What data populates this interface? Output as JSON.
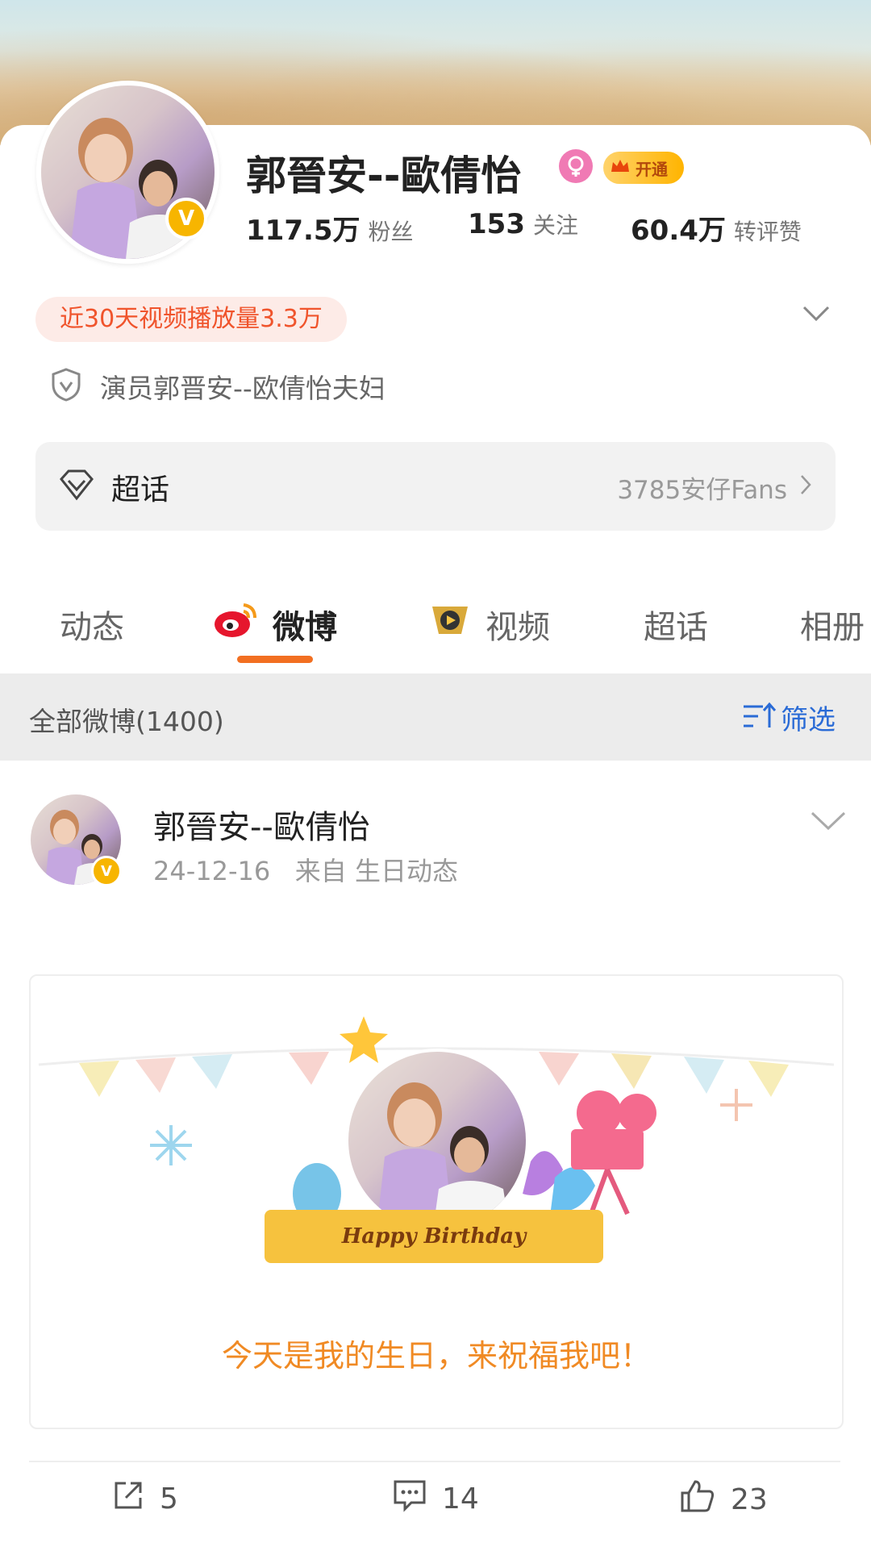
{
  "profile": {
    "name": "郭晉安--歐倩怡",
    "vip_label": "开通",
    "stats": [
      {
        "value": "117.5万",
        "label": "粉丝"
      },
      {
        "value": "153",
        "label": "关注"
      },
      {
        "value": "60.4万",
        "label": "转评赞"
      }
    ],
    "video_pill": "近30天视频播放量3.3万",
    "verification": "演员郭晋安--欧倩怡夫妇"
  },
  "chaohua": {
    "label": "超话",
    "fans": "3785安仔Fans"
  },
  "tabs": [
    "动态",
    "微博",
    "视频",
    "超话",
    "相册"
  ],
  "filter": {
    "all_label": "全部微博(1400)",
    "filter_label": "筛选"
  },
  "post": {
    "author": "郭晉安--歐倩怡",
    "meta": "24-12-16   来自 生日动态",
    "birthday_banner": "Happy Birthday",
    "birthday_message": "今天是我的生日，来祝福我吧！",
    "reposts": "5",
    "comments": "14",
    "likes": "23"
  },
  "colors": {
    "accent": "#f26f21",
    "pill_text": "#f0542c",
    "filter_blue": "#2a6bd6",
    "verified_gold": "#f7b500"
  }
}
